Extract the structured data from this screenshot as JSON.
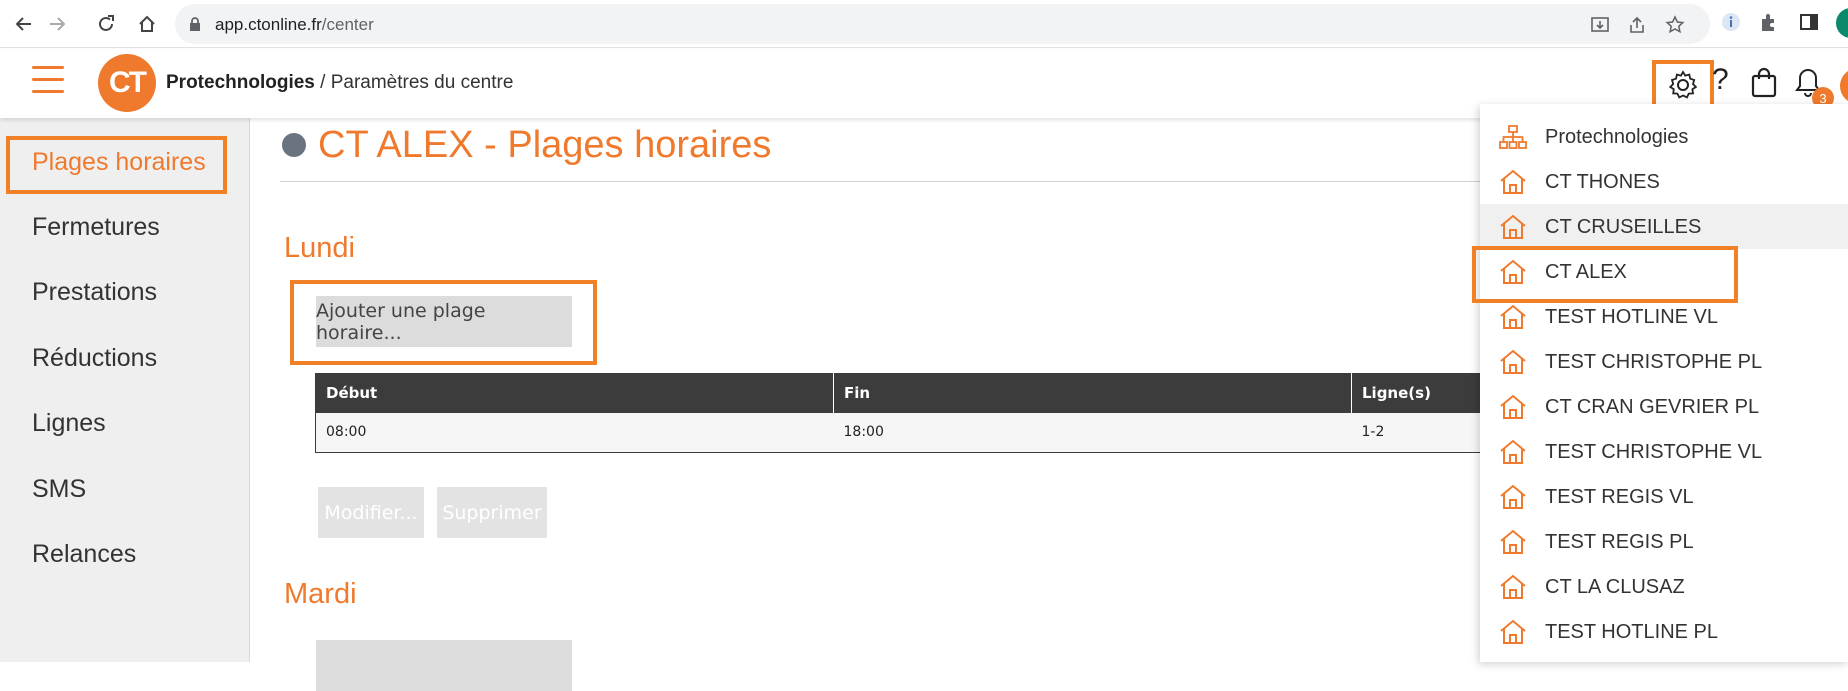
{
  "browser": {
    "url_domain": "app.ctonline.fr",
    "url_path": "/center"
  },
  "header": {
    "logo_text": "CT",
    "org_name": "Protechnologies",
    "separator": " / ",
    "page_name": "Paramètres du centre",
    "notification_count": "3",
    "help_label": "?"
  },
  "sidebar": {
    "items": [
      {
        "label": "Plages horaires",
        "active": true
      },
      {
        "label": "Fermetures"
      },
      {
        "label": "Prestations"
      },
      {
        "label": "Réductions"
      },
      {
        "label": "Lignes"
      },
      {
        "label": "SMS"
      },
      {
        "label": "Relances"
      }
    ]
  },
  "main": {
    "title": "CT ALEX - Plages horaires",
    "days": [
      {
        "name": "Lundi"
      },
      {
        "name": "Mardi"
      }
    ],
    "add_button": "Ajouter une plage horaire...",
    "edit_button": "Modifier...",
    "delete_button": "Supprimer",
    "table": {
      "headers": [
        "Début",
        "Fin",
        "Ligne(s)"
      ],
      "rows": [
        [
          "08:00",
          "18:00",
          "1-2"
        ]
      ]
    }
  },
  "dropdown": {
    "items": [
      {
        "label": "Protechnologies",
        "icon": "org-chart-icon"
      },
      {
        "label": "CT THONES",
        "icon": "house-icon"
      },
      {
        "label": "CT CRUSEILLES",
        "icon": "house-icon",
        "hover": true
      },
      {
        "label": "CT ALEX",
        "icon": "house-icon",
        "highlighted": true
      },
      {
        "label": "TEST HOTLINE VL",
        "icon": "house-icon"
      },
      {
        "label": "TEST CHRISTOPHE PL",
        "icon": "house-icon"
      },
      {
        "label": "CT CRAN GEVRIER PL",
        "icon": "house-icon"
      },
      {
        "label": "TEST CHRISTOPHE VL",
        "icon": "house-icon"
      },
      {
        "label": "TEST REGIS VL",
        "icon": "house-icon"
      },
      {
        "label": "TEST REGIS PL",
        "icon": "house-icon"
      },
      {
        "label": "CT LA CLUSAZ",
        "icon": "house-icon"
      },
      {
        "label": "TEST HOTLINE PL",
        "icon": "house-icon"
      }
    ]
  },
  "colors": {
    "accent": "#ef7a2d",
    "highlight_border": "#f08127",
    "table_header": "#3c3c3c"
  }
}
